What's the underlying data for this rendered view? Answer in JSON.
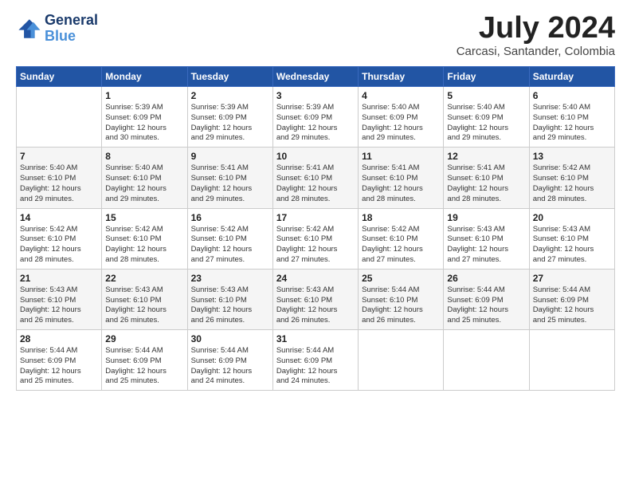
{
  "header": {
    "logo_line1": "General",
    "logo_line2": "Blue",
    "month": "July 2024",
    "location": "Carcasi, Santander, Colombia"
  },
  "days_of_week": [
    "Sunday",
    "Monday",
    "Tuesday",
    "Wednesday",
    "Thursday",
    "Friday",
    "Saturday"
  ],
  "weeks": [
    [
      {
        "day": "",
        "detail": ""
      },
      {
        "day": "1",
        "detail": "Sunrise: 5:39 AM\nSunset: 6:09 PM\nDaylight: 12 hours\nand 30 minutes."
      },
      {
        "day": "2",
        "detail": "Sunrise: 5:39 AM\nSunset: 6:09 PM\nDaylight: 12 hours\nand 29 minutes."
      },
      {
        "day": "3",
        "detail": "Sunrise: 5:39 AM\nSunset: 6:09 PM\nDaylight: 12 hours\nand 29 minutes."
      },
      {
        "day": "4",
        "detail": "Sunrise: 5:40 AM\nSunset: 6:09 PM\nDaylight: 12 hours\nand 29 minutes."
      },
      {
        "day": "5",
        "detail": "Sunrise: 5:40 AM\nSunset: 6:09 PM\nDaylight: 12 hours\nand 29 minutes."
      },
      {
        "day": "6",
        "detail": "Sunrise: 5:40 AM\nSunset: 6:10 PM\nDaylight: 12 hours\nand 29 minutes."
      }
    ],
    [
      {
        "day": "7",
        "detail": "Sunrise: 5:40 AM\nSunset: 6:10 PM\nDaylight: 12 hours\nand 29 minutes."
      },
      {
        "day": "8",
        "detail": "Sunrise: 5:40 AM\nSunset: 6:10 PM\nDaylight: 12 hours\nand 29 minutes."
      },
      {
        "day": "9",
        "detail": "Sunrise: 5:41 AM\nSunset: 6:10 PM\nDaylight: 12 hours\nand 29 minutes."
      },
      {
        "day": "10",
        "detail": "Sunrise: 5:41 AM\nSunset: 6:10 PM\nDaylight: 12 hours\nand 28 minutes."
      },
      {
        "day": "11",
        "detail": "Sunrise: 5:41 AM\nSunset: 6:10 PM\nDaylight: 12 hours\nand 28 minutes."
      },
      {
        "day": "12",
        "detail": "Sunrise: 5:41 AM\nSunset: 6:10 PM\nDaylight: 12 hours\nand 28 minutes."
      },
      {
        "day": "13",
        "detail": "Sunrise: 5:42 AM\nSunset: 6:10 PM\nDaylight: 12 hours\nand 28 minutes."
      }
    ],
    [
      {
        "day": "14",
        "detail": "Sunrise: 5:42 AM\nSunset: 6:10 PM\nDaylight: 12 hours\nand 28 minutes."
      },
      {
        "day": "15",
        "detail": "Sunrise: 5:42 AM\nSunset: 6:10 PM\nDaylight: 12 hours\nand 28 minutes."
      },
      {
        "day": "16",
        "detail": "Sunrise: 5:42 AM\nSunset: 6:10 PM\nDaylight: 12 hours\nand 27 minutes."
      },
      {
        "day": "17",
        "detail": "Sunrise: 5:42 AM\nSunset: 6:10 PM\nDaylight: 12 hours\nand 27 minutes."
      },
      {
        "day": "18",
        "detail": "Sunrise: 5:42 AM\nSunset: 6:10 PM\nDaylight: 12 hours\nand 27 minutes."
      },
      {
        "day": "19",
        "detail": "Sunrise: 5:43 AM\nSunset: 6:10 PM\nDaylight: 12 hours\nand 27 minutes."
      },
      {
        "day": "20",
        "detail": "Sunrise: 5:43 AM\nSunset: 6:10 PM\nDaylight: 12 hours\nand 27 minutes."
      }
    ],
    [
      {
        "day": "21",
        "detail": "Sunrise: 5:43 AM\nSunset: 6:10 PM\nDaylight: 12 hours\nand 26 minutes."
      },
      {
        "day": "22",
        "detail": "Sunrise: 5:43 AM\nSunset: 6:10 PM\nDaylight: 12 hours\nand 26 minutes."
      },
      {
        "day": "23",
        "detail": "Sunrise: 5:43 AM\nSunset: 6:10 PM\nDaylight: 12 hours\nand 26 minutes."
      },
      {
        "day": "24",
        "detail": "Sunrise: 5:43 AM\nSunset: 6:10 PM\nDaylight: 12 hours\nand 26 minutes."
      },
      {
        "day": "25",
        "detail": "Sunrise: 5:44 AM\nSunset: 6:10 PM\nDaylight: 12 hours\nand 26 minutes."
      },
      {
        "day": "26",
        "detail": "Sunrise: 5:44 AM\nSunset: 6:09 PM\nDaylight: 12 hours\nand 25 minutes."
      },
      {
        "day": "27",
        "detail": "Sunrise: 5:44 AM\nSunset: 6:09 PM\nDaylight: 12 hours\nand 25 minutes."
      }
    ],
    [
      {
        "day": "28",
        "detail": "Sunrise: 5:44 AM\nSunset: 6:09 PM\nDaylight: 12 hours\nand 25 minutes."
      },
      {
        "day": "29",
        "detail": "Sunrise: 5:44 AM\nSunset: 6:09 PM\nDaylight: 12 hours\nand 25 minutes."
      },
      {
        "day": "30",
        "detail": "Sunrise: 5:44 AM\nSunset: 6:09 PM\nDaylight: 12 hours\nand 24 minutes."
      },
      {
        "day": "31",
        "detail": "Sunrise: 5:44 AM\nSunset: 6:09 PM\nDaylight: 12 hours\nand 24 minutes."
      },
      {
        "day": "",
        "detail": ""
      },
      {
        "day": "",
        "detail": ""
      },
      {
        "day": "",
        "detail": ""
      }
    ]
  ]
}
